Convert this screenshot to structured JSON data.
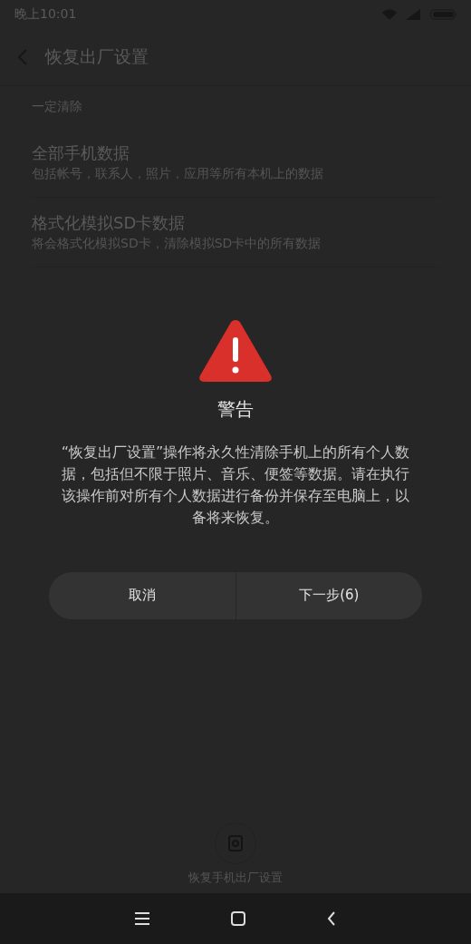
{
  "status_bar": {
    "time": "晚上10:01"
  },
  "header": {
    "title": "恢复出厂设置"
  },
  "section": {
    "label": "一定清除",
    "items": [
      {
        "title": "全部手机数据",
        "subtitle": "包括帐号，联系人，照片，应用等所有本机上的数据"
      },
      {
        "title": "格式化模拟SD卡数据",
        "subtitle": "将会格式化模拟SD卡，清除模拟SD卡中的所有数据"
      }
    ]
  },
  "dialog": {
    "title": "警告",
    "message": "“恢复出厂设置”操作将永久性清除手机上的所有个人数据，包括但不限于照片、音乐、便签等数据。请在执行该操作前对所有个人数据进行备份并保存至电脑上，以备将来恢复。",
    "buttons": [
      {
        "label": "取消"
      },
      {
        "label": "下一步(6)"
      }
    ]
  },
  "bottom_action": {
    "label": "恢复手机出厂设置"
  }
}
